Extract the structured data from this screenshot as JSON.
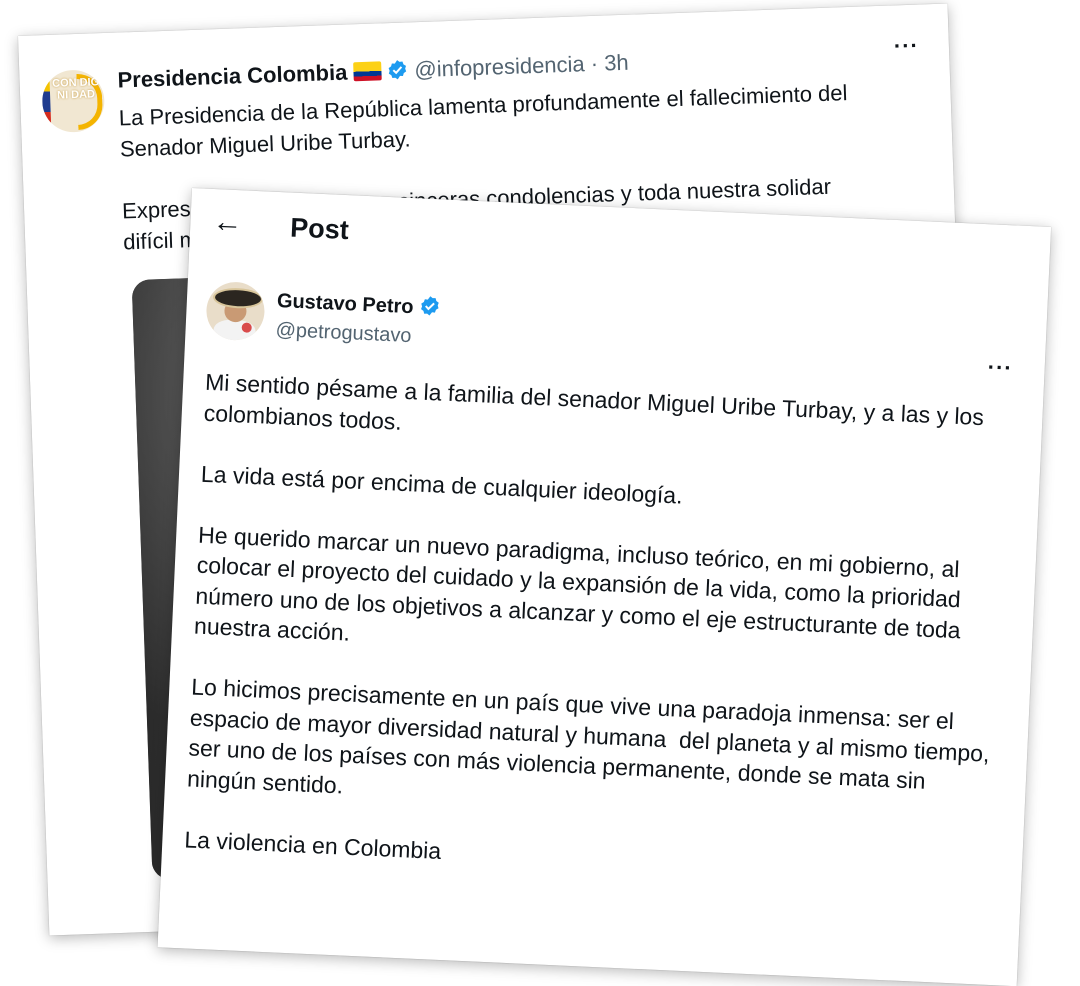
{
  "back_post": {
    "author_name": "Presidencia Colombia",
    "handle": "@infopresidencia",
    "separator": "·",
    "time": "3h",
    "avatar_text": "CON DIG NI DAD",
    "paragraphs": [
      "La Presidencia de la República lamenta profundamente el fallecimiento del Senador Miguel Uribe Turbay.",
      "Expres                                  sinceras condolencias y toda nuestra solidar                                                                    difícil momento."
    ],
    "more_label": "···"
  },
  "front_post": {
    "page_title": "Post",
    "back_arrow": "←",
    "author_name": "Gustavo Petro",
    "handle": "@petrogustavo",
    "more_label": "···",
    "paragraphs": [
      "Mi sentido pésame a la familia del senador Miguel Uribe Turbay, y a las y los colombianos todos.",
      "La vida está por encima de cualquier ideología.",
      "He querido marcar un nuevo paradigma, incluso teórico, en mi gobierno, al colocar el proyecto del cuidado y la expansión de la vida, como la prioridad número uno de los objetivos a alcanzar y como el eje estructurante de toda nuestra acción.",
      "Lo hicimos precisamente en un país que vive una paradoja inmensa: ser el espacio de mayor diversidad natural y humana  del planeta y al mismo tiempo, ser uno de los países con más violencia permanente, donde se mata sin ningún sentido.",
      "La violencia en Colombia"
    ]
  },
  "colors": {
    "verified": "#1d9bf0",
    "text": "#0f1419",
    "secondary": "#536471"
  }
}
